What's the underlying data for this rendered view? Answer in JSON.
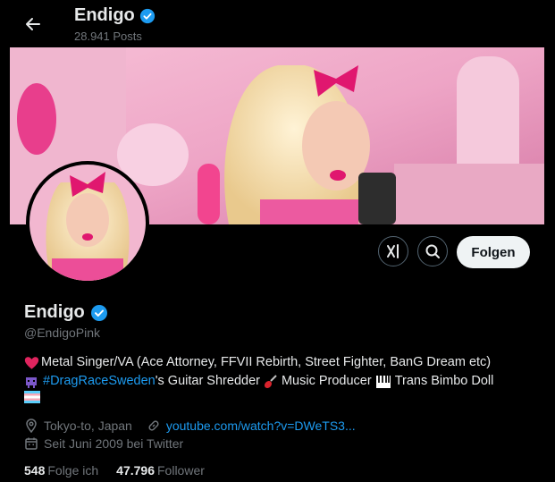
{
  "header": {
    "title": "Endigo",
    "posts_count": "28.941 Posts"
  },
  "profile": {
    "name": "Endigo",
    "handle": "@EndigoPink",
    "bio_line1": "Metal Singer/VA (Ace Attorney, FFVII Rebirth, Street Fighter, BanG Dream etc)",
    "bio_hashtag": "#DragRaceSweden",
    "bio_line2_rest": "'s Guitar Shredder",
    "bio_music": "Music Producer",
    "bio_trans": "Trans Bimbo Doll",
    "location": "Tokyo-to, Japan",
    "website": "youtube.com/watch?v=DWeTS3...",
    "joined": "Seit Juni 2009 bei Twitter",
    "following_count": "548",
    "following_label": "Folge ich",
    "followers_count": "47.796",
    "followers_label": "Follower"
  },
  "actions": {
    "follow_label": "Folgen"
  },
  "colors": {
    "accent": "#1d9bf0",
    "verified": "#1d9bf0",
    "muted": "#71767b"
  },
  "icons": [
    "back-arrow-icon",
    "verified-icon",
    "grok-icon",
    "search-icon",
    "location-icon",
    "link-icon",
    "calendar-icon"
  ]
}
